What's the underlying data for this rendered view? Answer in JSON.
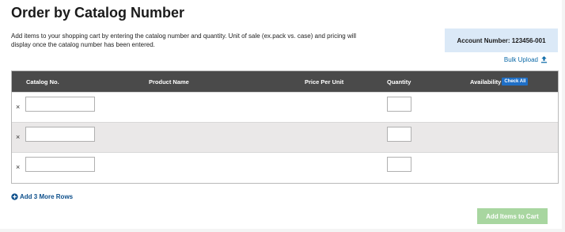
{
  "page": {
    "title": "Order by Catalog Number",
    "intro": "Add items to your shopping cart by entering the catalog number and quantity. Unit of sale (ex.pack vs. case) and pricing will display once the catalog number has been entered."
  },
  "account": {
    "label": "Account Number: 123456-001"
  },
  "bulk_upload": {
    "label": "Bulk Upload",
    "icon": "upload-icon"
  },
  "table": {
    "headers": {
      "catalog_no": "Catalog No.",
      "product_name": "Product Name",
      "price_per_unit": "Price Per Unit",
      "quantity": "Quantity",
      "availability": "Availability"
    },
    "check_all_label": "Check All",
    "rows": [
      {
        "remove_symbol": "×",
        "catalog_no": "",
        "quantity": ""
      },
      {
        "remove_symbol": "×",
        "catalog_no": "",
        "quantity": ""
      },
      {
        "remove_symbol": "×",
        "catalog_no": "",
        "quantity": ""
      }
    ]
  },
  "add_rows": {
    "label": "Add 3 More Rows",
    "icon": "plus-circle-icon"
  },
  "cart": {
    "button_label": "Add Items to Cart"
  },
  "colors": {
    "header_bg": "#4a4a4a",
    "account_bg": "#dbe9f7",
    "link": "#0d6aa8",
    "check_all_bg": "#1f6fc6",
    "cart_button_bg": "#a8d6a0",
    "alt_row_bg": "#eae8e8"
  }
}
